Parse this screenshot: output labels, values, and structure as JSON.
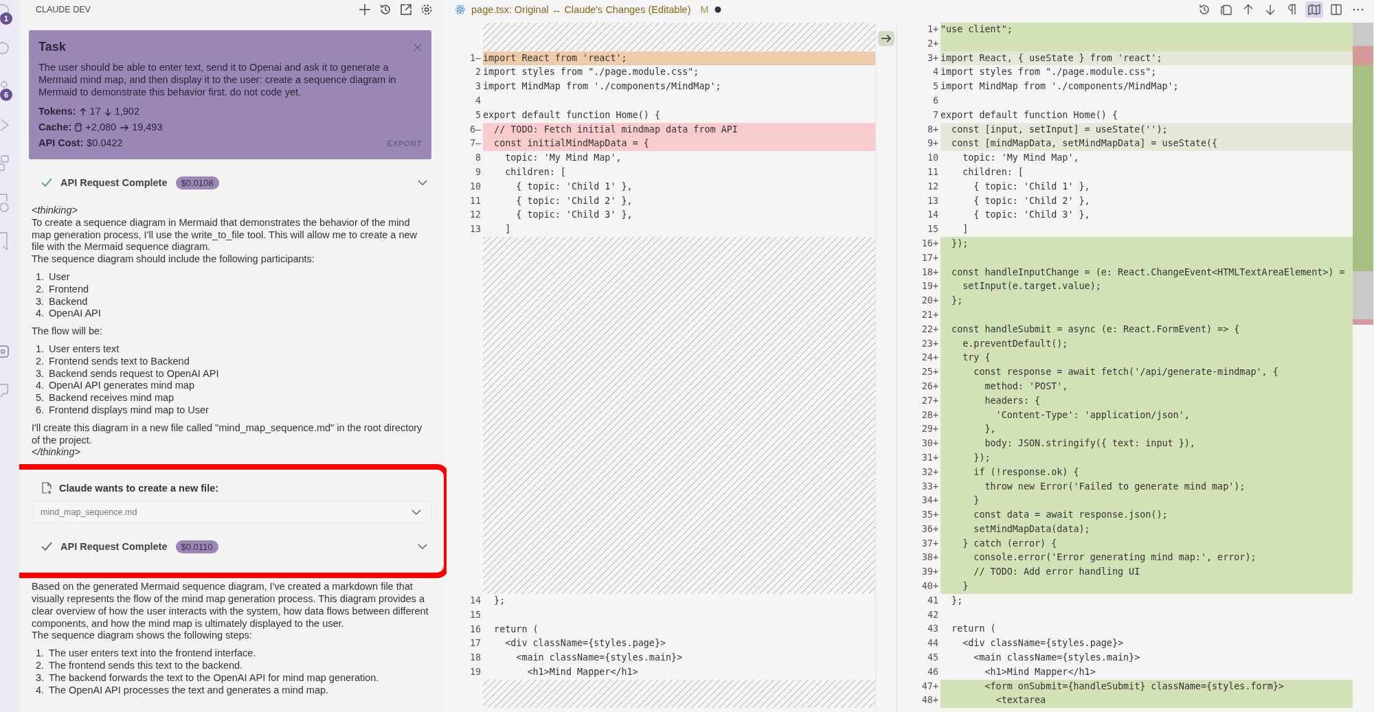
{
  "activity_bar": {
    "badges": [
      "1",
      "6"
    ]
  },
  "sidebar": {
    "title": "CLAUDE DEV",
    "task": {
      "title": "Task",
      "text": "The user should be able to enter text, send it to Openai and ask it to generate a Mermaid mind map, and then display it to the user: create a sequence diagram in Mermaid to demonstrate this behavior first. do not code yet.",
      "tokens_label": "Tokens:",
      "tokens_in": "17",
      "tokens_out": "1,902",
      "cache_label": "Cache:",
      "cache_write": "+2,080",
      "cache_read": "19,493",
      "cost_label": "API Cost:",
      "cost": "$0.0422",
      "export": "EXPORT"
    },
    "items": [
      {
        "kind": "api",
        "label": "API Request Complete",
        "cost": "$0.0108",
        "color": "#3f9b3f"
      },
      {
        "kind": "message",
        "blocks": [
          {
            "kind": "tag",
            "text": "<thinking>"
          },
          {
            "kind": "line",
            "text": "To create a sequence diagram in Mermaid that demonstrates the behavior of the mind map generation process, I'll use the write_to_file tool. This will allow me to create a new file with the Mermaid sequence diagram."
          },
          {
            "kind": "line",
            "text": "The sequence diagram should include the following participants:"
          },
          {
            "kind": "list",
            "items": [
              {
                "n": "1.",
                "text": "User"
              },
              {
                "n": "2.",
                "text": "Frontend"
              },
              {
                "n": "3.",
                "text": "Backend"
              },
              {
                "n": "4.",
                "text": "OpenAI API"
              }
            ]
          },
          {
            "kind": "line",
            "text": "The flow will be:"
          },
          {
            "kind": "list",
            "items": [
              {
                "n": "1.",
                "text": "User enters text"
              },
              {
                "n": "2.",
                "text": "Frontend sends text to Backend"
              },
              {
                "n": "3.",
                "text": "Backend sends request to OpenAI API"
              },
              {
                "n": "4.",
                "text": "OpenAI API generates mind map"
              },
              {
                "n": "5.",
                "text": "Backend receives mind map"
              },
              {
                "n": "6.",
                "text": "Frontend displays mind map to User"
              }
            ]
          },
          {
            "kind": "line",
            "text": "I'll create this diagram in a new file called \"mind_map_sequence.md\" in the root directory of the project."
          },
          {
            "kind": "tag",
            "text": "</thinking>"
          }
        ]
      },
      {
        "kind": "file",
        "label": "Claude wants to create a new file:",
        "filename": "mind_map_sequence.md"
      },
      {
        "kind": "api",
        "label": "API Request Complete",
        "cost": "$0.0110",
        "color": "#555555"
      },
      {
        "kind": "message",
        "blocks": [
          {
            "kind": "line",
            "text": "Based on the generated Mermaid sequence diagram, I've created a markdown file that visually represents the flow of the mind map generation process. This diagram provides a clear overview of how the user interacts with the system, how data flows between different components, and how the mind map is ultimately displayed to the user."
          },
          {
            "kind": "line",
            "text": "The sequence diagram shows the following steps:"
          },
          {
            "kind": "list",
            "items": [
              {
                "n": "1.",
                "text": "The user enters text into the frontend interface."
              },
              {
                "n": "2.",
                "text": "The frontend sends this text to the backend."
              },
              {
                "n": "3.",
                "text": "The backend forwards the text to the OpenAI API for mind map generation."
              },
              {
                "n": "4.",
                "text": "The OpenAI API processes the text and generates a mind map."
              }
            ]
          }
        ]
      }
    ]
  },
  "editor_tab": {
    "title": "page.tsx: Original ↔ Claude's Changes (Editable)",
    "status": "M",
    "unsaved": true
  },
  "toolbar": [
    {
      "kind": "history",
      "on": false
    },
    {
      "kind": "copy",
      "on": false
    },
    {
      "kind": "up",
      "on": false
    },
    {
      "kind": "down",
      "on": false
    },
    {
      "kind": "pilcrow",
      "on": false
    },
    {
      "kind": "map",
      "on": true
    },
    {
      "kind": "split",
      "on": false
    },
    {
      "kind": "more",
      "on": false
    }
  ],
  "left_editor": {
    "blocks": [
      {
        "kind": "gap"
      },
      {
        "kind": "lines",
        "lines": [
          {
            "gutter": "1—",
            "text": "import React from 'react';",
            "kind": "modified"
          },
          {
            "gutter": "2",
            "text": "import styles from \"./page.module.css\";"
          },
          {
            "gutter": "3",
            "text": "import MindMap from './components/MindMap';"
          },
          {
            "gutter": "4"
          },
          {
            "gutter": "5",
            "text": "export default function Home() {"
          },
          {
            "gutter": "6—",
            "text": "  // TODO: Fetch initial mindmap data from API",
            "kind": "removed"
          },
          {
            "gutter": "7—",
            "text": "  const initialMindMapData = {",
            "kind": "removed"
          },
          {
            "gutter": "8",
            "text": "    topic: 'My Mind Map',"
          },
          {
            "gutter": "9",
            "text": "    children: ["
          },
          {
            "gutter": "10",
            "text": "      { topic: 'Child 1' },"
          },
          {
            "gutter": "11",
            "text": "      { topic: 'Child 2' },"
          },
          {
            "gutter": "12",
            "text": "      { topic: 'Child 3' },"
          },
          {
            "gutter": "13",
            "text": "    ]"
          }
        ]
      },
      {
        "kind": "gap"
      },
      {
        "kind": "lines",
        "lines": [
          {
            "gutter": "14",
            "text": "  };"
          },
          {
            "gutter": "15"
          },
          {
            "gutter": "16",
            "text": "  return ("
          },
          {
            "gutter": "17",
            "text": "    <div className={styles.page}>"
          },
          {
            "gutter": "18",
            "text": "      <main className={styles.main}>"
          },
          {
            "gutter": "19",
            "text": "        <h1>Mind Mapper</h1>"
          }
        ]
      },
      {
        "kind": "gap"
      }
    ]
  },
  "right_editor": {
    "lines": [
      {
        "gutter": "1+",
        "text": "\"use client\";",
        "kind": "added"
      },
      {
        "gutter": "2+",
        "kind": "added"
      },
      {
        "gutter": "3+",
        "text": "import React, { useState } from 'react';",
        "kind": "changed"
      },
      {
        "gutter": "4",
        "text": "import styles from \"./page.module.css\";"
      },
      {
        "gutter": "5",
        "text": "import MindMap from './components/MindMap';"
      },
      {
        "gutter": "6"
      },
      {
        "gutter": "7",
        "text": "export default function Home() {"
      },
      {
        "gutter": "8+",
        "text": "  const [input, setInput] = useState('');",
        "kind": "changed"
      },
      {
        "gutter": "9+",
        "text": "  const [mindMapData, setMindMapData] = useState({",
        "kind": "changed"
      },
      {
        "gutter": "10",
        "text": "    topic: 'My Mind Map',"
      },
      {
        "gutter": "11",
        "text": "    children: ["
      },
      {
        "gutter": "12",
        "text": "      { topic: 'Child 1' },"
      },
      {
        "gutter": "13",
        "text": "      { topic: 'Child 2' },"
      },
      {
        "gutter": "14",
        "text": "      { topic: 'Child 3' },"
      },
      {
        "gutter": "15",
        "text": "    ]"
      },
      {
        "gutter": "16+",
        "text": "  });",
        "kind": "added"
      },
      {
        "gutter": "17+",
        "kind": "added"
      },
      {
        "gutter": "18+",
        "text": "  const handleInputChange = (e: React.ChangeEvent<HTMLTextAreaElement>) =",
        "kind": "added"
      },
      {
        "gutter": "19+",
        "text": "    setInput(e.target.value);",
        "kind": "added"
      },
      {
        "gutter": "20+",
        "text": "  };",
        "kind": "added"
      },
      {
        "gutter": "21+",
        "kind": "added"
      },
      {
        "gutter": "22+",
        "text": "  const handleSubmit = async (e: React.FormEvent) => {",
        "kind": "added"
      },
      {
        "gutter": "23+",
        "text": "    e.preventDefault();",
        "kind": "added"
      },
      {
        "gutter": "24+",
        "text": "    try {",
        "kind": "added"
      },
      {
        "gutter": "25+",
        "text": "      const response = await fetch('/api/generate-mindmap', {",
        "kind": "added"
      },
      {
        "gutter": "26+",
        "text": "        method: 'POST',",
        "kind": "added"
      },
      {
        "gutter": "27+",
        "text": "        headers: {",
        "kind": "added"
      },
      {
        "gutter": "28+",
        "text": "          'Content-Type': 'application/json',",
        "kind": "added"
      },
      {
        "gutter": "29+",
        "text": "        },",
        "kind": "added"
      },
      {
        "gutter": "30+",
        "text": "        body: JSON.stringify({ text: input }),",
        "kind": "added"
      },
      {
        "gutter": "31+",
        "text": "      });",
        "kind": "added"
      },
      {
        "gutter": "32+",
        "text": "      if (!response.ok) {",
        "kind": "added"
      },
      {
        "gutter": "33+",
        "text": "        throw new Error('Failed to generate mind map');",
        "kind": "added"
      },
      {
        "gutter": "34+",
        "text": "      }",
        "kind": "added"
      },
      {
        "gutter": "35+",
        "text": "      const data = await response.json();",
        "kind": "added"
      },
      {
        "gutter": "36+",
        "text": "      setMindMapData(data);",
        "kind": "added"
      },
      {
        "gutter": "37+",
        "text": "    } catch (error) {",
        "kind": "added"
      },
      {
        "gutter": "38+",
        "text": "      console.error('Error generating mind map:', error);",
        "kind": "added"
      },
      {
        "gutter": "39+",
        "text": "      // TODO: Add error handling UI",
        "kind": "added"
      },
      {
        "gutter": "40+",
        "text": "    }",
        "kind": "added"
      },
      {
        "gutter": "41",
        "text": "  };"
      },
      {
        "gutter": "42"
      },
      {
        "gutter": "43",
        "text": "  return ("
      },
      {
        "gutter": "44",
        "text": "    <div className={styles.page}>"
      },
      {
        "gutter": "45",
        "text": "      <main className={styles.main}>"
      },
      {
        "gutter": "46",
        "text": "        <h1>Mind Mapper</h1>"
      },
      {
        "gutter": "47+",
        "text": "        <form onSubmit={handleSubmit} className={styles.form}>",
        "kind": "added"
      },
      {
        "gutter": "48+",
        "text": "          <textarea",
        "kind": "added"
      }
    ]
  }
}
